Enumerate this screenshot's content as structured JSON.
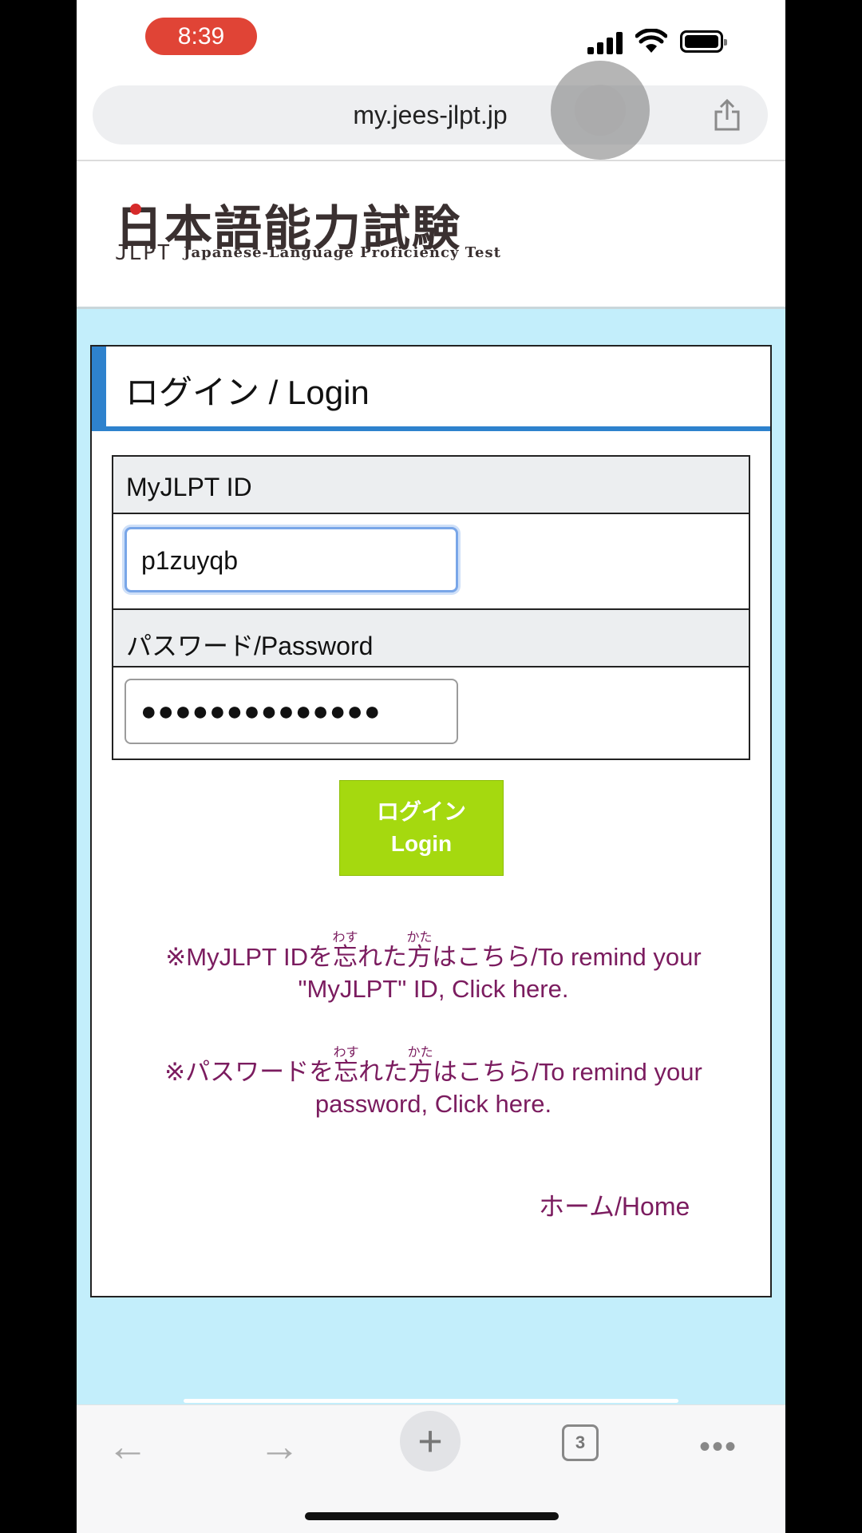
{
  "status_bar": {
    "time": "8:39"
  },
  "browser": {
    "url": "my.jees-jlpt.jp",
    "open_tabs": "3"
  },
  "site": {
    "logo_kanji": "日本語能力試験",
    "logo_jlpt": "JLPT",
    "logo_subtitle": "Japanese-Language Proficiency Test"
  },
  "login_form": {
    "title": "ログイン / Login",
    "id_label": "MyJLPT ID",
    "id_value": "p1zuyqb",
    "password_label": "パスワード/Password",
    "password_mask": "●●●●●●●●●●●●●●",
    "button_line1": "ログイン",
    "button_line2": "Login"
  },
  "links": {
    "remind_id_prefix": "※MyJLPT IDを",
    "remind_id_k1": "忘",
    "remind_id_r1": "わす",
    "remind_id_mid": "れた",
    "remind_id_k2": "方",
    "remind_id_r2": "かた",
    "remind_id_suffix": "はこちら/To remind your",
    "remind_id_line2": "\"MyJLPT\" ID, Click here.",
    "remind_pw_prefix": "※パスワードを",
    "remind_pw_k1": "忘",
    "remind_pw_r1": "わす",
    "remind_pw_mid": "れた",
    "remind_pw_k2": "方",
    "remind_pw_r2": "かた",
    "remind_pw_suffix": "はこちら/To remind your",
    "remind_pw_line2": "password, Click here.",
    "home": "ホーム/Home"
  },
  "toolbar": {
    "back_icon": "←",
    "forward_icon": "→",
    "new_tab_icon": "+",
    "more_icon": "•••"
  },
  "colors": {
    "accent_blue": "#2e82cd",
    "login_green": "#a5d90f",
    "link_purple": "#7b1c5f",
    "page_bg": "#c3eefb",
    "time_pill": "#e04436"
  }
}
